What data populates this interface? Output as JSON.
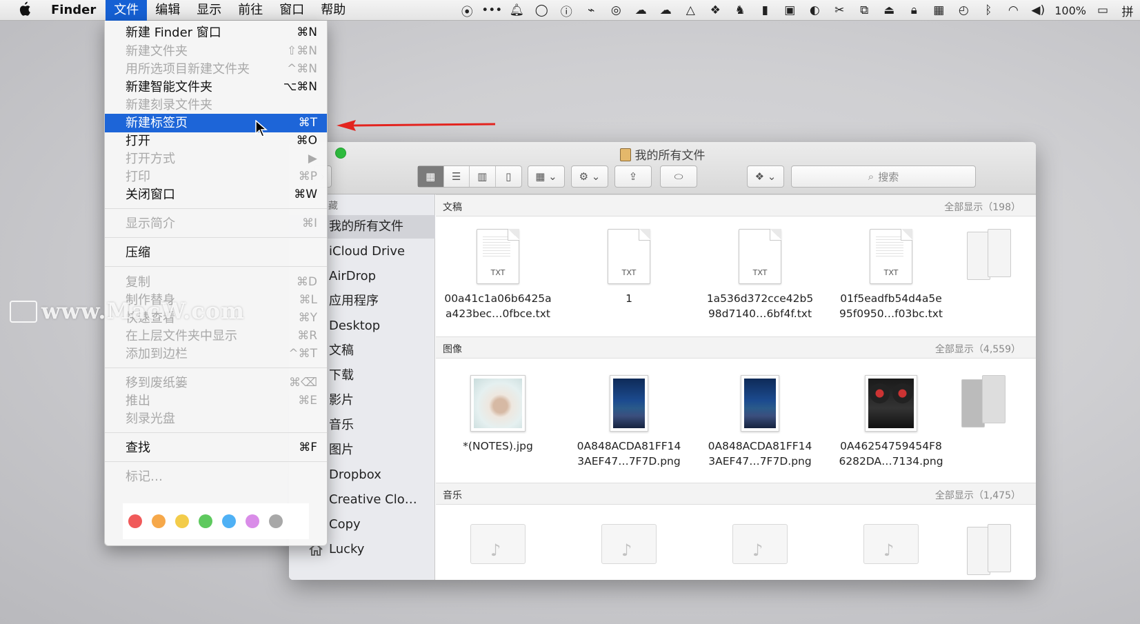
{
  "menubar": {
    "app": "Finder",
    "menus": [
      "文件",
      "编辑",
      "显示",
      "前往",
      "窗口",
      "帮助"
    ],
    "battery": "100%",
    "input_method": "拼"
  },
  "file_menu": {
    "items": [
      {
        "label": "新建 Finder 窗口",
        "shortcut": "⌘N"
      },
      {
        "label": "新建文件夹",
        "shortcut": "⇧⌘N"
      },
      {
        "label": "用所选项目新建文件夹",
        "shortcut": "^⌘N"
      },
      {
        "label": "新建智能文件夹",
        "shortcut": "⌥⌘N"
      },
      {
        "label": "新建刻录文件夹",
        "shortcut": ""
      },
      {
        "label": "新建标签页",
        "shortcut": "⌘T"
      },
      {
        "label": "打开",
        "shortcut": "⌘O"
      },
      {
        "label": "打开方式",
        "shortcut": "▶"
      },
      {
        "label": "打印",
        "shortcut": "⌘P"
      },
      {
        "label": "关闭窗口",
        "shortcut": "⌘W"
      },
      {
        "label": "显示简介",
        "shortcut": "⌘I"
      },
      {
        "label": "压缩",
        "shortcut": ""
      },
      {
        "label": "复制",
        "shortcut": "⌘D"
      },
      {
        "label": "制作替身",
        "shortcut": "⌘L"
      },
      {
        "label": "快速查看",
        "shortcut": "⌘Y"
      },
      {
        "label": "在上层文件夹中显示",
        "shortcut": "⌘R"
      },
      {
        "label": "添加到边栏",
        "shortcut": "^⌘T"
      },
      {
        "label": "移到废纸篓",
        "shortcut": "⌘⌫"
      },
      {
        "label": "推出",
        "shortcut": "⌘E"
      },
      {
        "label": "刻录光盘",
        "shortcut": ""
      },
      {
        "label": "查找",
        "shortcut": "⌘F"
      },
      {
        "label": "标记…",
        "shortcut": ""
      }
    ],
    "tag_colors": [
      "#f05a5a",
      "#f6a84a",
      "#f3cc4a",
      "#5ec95e",
      "#4fb1f5",
      "#d98ce8",
      "#a8a8a8"
    ]
  },
  "finder": {
    "title": "我的所有文件",
    "search_placeholder": "搜索",
    "sidebar_header": "藏",
    "sidebar": [
      "我的所有文件",
      "iCloud Drive",
      "AirDrop",
      "应用程序",
      "Desktop",
      "文稿",
      "下载",
      "影片",
      "音乐",
      "图片",
      "Dropbox",
      "Creative Clo…",
      "Copy",
      "Lucky"
    ],
    "sections": [
      {
        "title": "文稿",
        "more": "全部显示（198）",
        "files": [
          {
            "line1": "00a41c1a06b6425a",
            "line2": "a423bec…0fbce.txt",
            "tag": "TXT"
          },
          {
            "line1": "1",
            "line2": "",
            "tag": "TXT"
          },
          {
            "line1": "1a536d372cce42b5",
            "line2": "98d7140…6bf4f.txt",
            "tag": "TXT"
          },
          {
            "line1": "01f5eadfb54d4a5e",
            "line2": "95f0950…f03bc.txt",
            "tag": "TXT"
          }
        ]
      },
      {
        "title": "图像",
        "more": "全部显示（4,559）",
        "files": [
          {
            "line1": "*(NOTES).jpg",
            "line2": ""
          },
          {
            "line1": "0A848ACDA81FF14",
            "line2": "3AEF47…7F7D.png"
          },
          {
            "line1": "0A848ACDA81FF14",
            "line2": "3AEF47…7F7D.png"
          },
          {
            "line1": "0A46254759454F8",
            "line2": "6282DA…7134.png"
          }
        ]
      },
      {
        "title": "音乐",
        "more": "全部显示（1,475）"
      }
    ]
  },
  "watermark": "www.MacW.com"
}
